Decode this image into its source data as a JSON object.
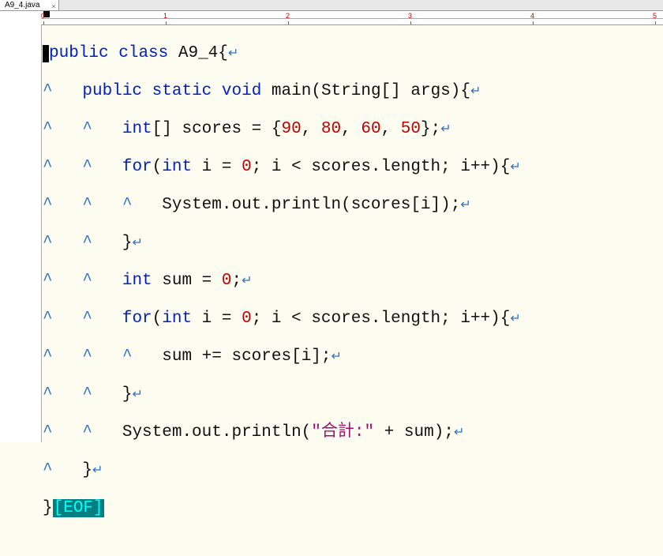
{
  "tab": {
    "filename": "A9_4.java"
  },
  "ruler": {
    "marks": [
      0,
      1,
      2,
      3,
      4,
      5
    ]
  },
  "gutter": {
    "lines": 13
  },
  "code": {
    "lines": [
      {
        "keyword1": "public",
        "keyword2": "class",
        "classname": "A9_4"
      },
      {
        "keyword1": "public",
        "keyword2": "static",
        "keyword3": "void",
        "method": "main",
        "params": "(String[] args){"
      },
      {
        "type": "int",
        "decl": "[] scores = {",
        "n1": "90",
        "c1": ", ",
        "n2": "80",
        "c2": ", ",
        "n3": "60",
        "c3": ", ",
        "n4": "50",
        "end": "};"
      },
      {
        "kw": "for",
        "open": "(",
        "type": "int",
        "init": " i = ",
        "zero": "0",
        "rest": "; i < scores.length; i++){"
      },
      {
        "stmt": "System.out.println(scores[i]);"
      },
      {
        "close": "}"
      },
      {
        "type": "int",
        "init": " sum = ",
        "zero": "0",
        "semi": ";"
      },
      {
        "kw": "for",
        "open": "(",
        "type": "int",
        "init": " i = ",
        "zero": "0",
        "rest": "; i < scores.length; i++){"
      },
      {
        "stmt": "sum += scores[i];"
      },
      {
        "close": "}"
      },
      {
        "call": "System.out.println(",
        "str": "\"合計:\"",
        "rest": " + sum);"
      },
      {
        "close": "}"
      },
      {
        "close": "}",
        "eof": "[EOF]"
      }
    ]
  },
  "symbols": {
    "eol": "↵",
    "caret": "^"
  }
}
